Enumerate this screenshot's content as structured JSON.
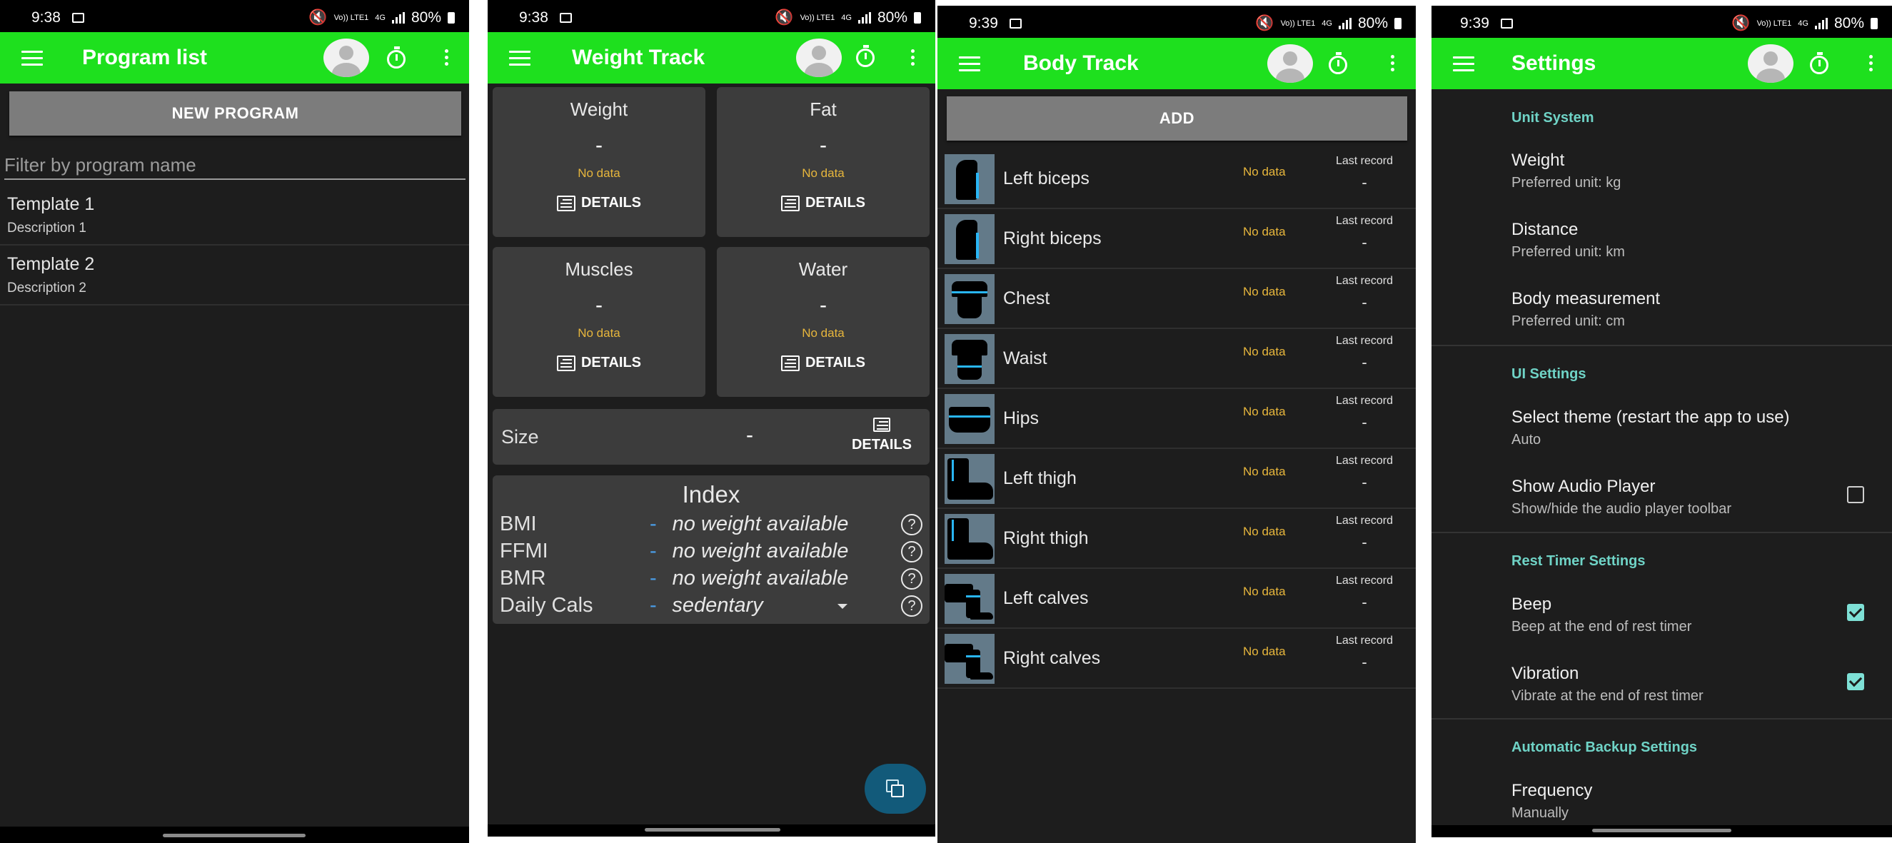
{
  "colors": {
    "accent_green": "#1ee01e",
    "background": "#1d1d1d",
    "card": "#3c3c3c",
    "no_data": "#e7b63c",
    "section_teal": "#6fd3c6"
  },
  "screens": [
    {
      "status": {
        "time": "9:38",
        "net_top": "Vo)) LTE1",
        "net_mid": "4G",
        "battery": "80%"
      },
      "title": "Program list",
      "new_program_label": "NEW PROGRAM",
      "filter_placeholder": "Filter by program name",
      "programs": [
        {
          "name": "Template 1",
          "description": "Description 1"
        },
        {
          "name": "Template 2",
          "description": "Description 2"
        }
      ]
    },
    {
      "status": {
        "time": "9:38",
        "net_top": "Vo)) LTE1",
        "net_mid": "4G",
        "battery": "80%"
      },
      "title": "Weight Track",
      "cards": [
        {
          "title": "Weight",
          "value": "-",
          "note": "No data",
          "details_label": "DETAILS"
        },
        {
          "title": "Fat",
          "value": "-",
          "note": "No data",
          "details_label": "DETAILS"
        },
        {
          "title": "Muscles",
          "value": "-",
          "note": "No data",
          "details_label": "DETAILS"
        },
        {
          "title": "Water",
          "value": "-",
          "note": "No data",
          "details_label": "DETAILS"
        }
      ],
      "size": {
        "label": "Size",
        "value": "-",
        "details_label": "DETAILS"
      },
      "index": {
        "title": "Index",
        "rows": [
          {
            "label": "BMI",
            "dash": "-",
            "value": "no weight available",
            "help": "?"
          },
          {
            "label": "FFMI",
            "dash": "-",
            "value": "no weight available",
            "help": "?"
          },
          {
            "label": "BMR",
            "dash": "-",
            "value": "no weight available",
            "help": "?"
          },
          {
            "label": "Daily Cals",
            "dash": "-",
            "value": "sedentary",
            "help": "?"
          }
        ]
      }
    },
    {
      "status": {
        "time": "9:39",
        "net_top": "Vo)) LTE1",
        "net_mid": "4G",
        "battery": "80%"
      },
      "title": "Body Track",
      "add_label": "ADD",
      "parts": [
        {
          "name": "Left biceps",
          "note": "No data",
          "last_label": "Last record",
          "last_value": "-"
        },
        {
          "name": "Right biceps",
          "note": "No data",
          "last_label": "Last record",
          "last_value": "-"
        },
        {
          "name": "Chest",
          "note": "No data",
          "last_label": "Last record",
          "last_value": "-"
        },
        {
          "name": "Waist",
          "note": "No data",
          "last_label": "Last record",
          "last_value": "-"
        },
        {
          "name": "Hips",
          "note": "No data",
          "last_label": "Last record",
          "last_value": "-"
        },
        {
          "name": "Left thigh",
          "note": "No data",
          "last_label": "Last record",
          "last_value": "-"
        },
        {
          "name": "Right thigh",
          "note": "No data",
          "last_label": "Last record",
          "last_value": "-"
        },
        {
          "name": "Left calves",
          "note": "No data",
          "last_label": "Last record",
          "last_value": "-"
        },
        {
          "name": "Right calves",
          "note": "No data",
          "last_label": "Last record",
          "last_value": "-"
        }
      ]
    },
    {
      "status": {
        "time": "9:39",
        "net_top": "Vo)) LTE1",
        "net_mid": "4G",
        "battery": "80%"
      },
      "title": "Settings",
      "sections": {
        "unit": "Unit System",
        "ui": "UI Settings",
        "rest": "Rest Timer Settings",
        "backup": "Automatic Backup Settings"
      },
      "prefs": {
        "weight": {
          "title": "Weight",
          "summary": "Preferred unit: kg"
        },
        "distance": {
          "title": "Distance",
          "summary": "Preferred unit: km"
        },
        "body": {
          "title": "Body measurement",
          "summary": "Preferred unit: cm"
        },
        "theme": {
          "title": "Select theme (restart the app to use)",
          "summary": "Auto"
        },
        "audio": {
          "title": "Show Audio Player",
          "summary": "Show/hide the audio player toolbar",
          "checked": false
        },
        "beep": {
          "title": "Beep",
          "summary": "Beep at the end of rest timer",
          "checked": true
        },
        "vibration": {
          "title": "Vibration",
          "summary": "Vibrate at the end of rest timer",
          "checked": true
        },
        "frequency": {
          "title": "Frequency",
          "summary": "Manually"
        }
      }
    }
  ]
}
